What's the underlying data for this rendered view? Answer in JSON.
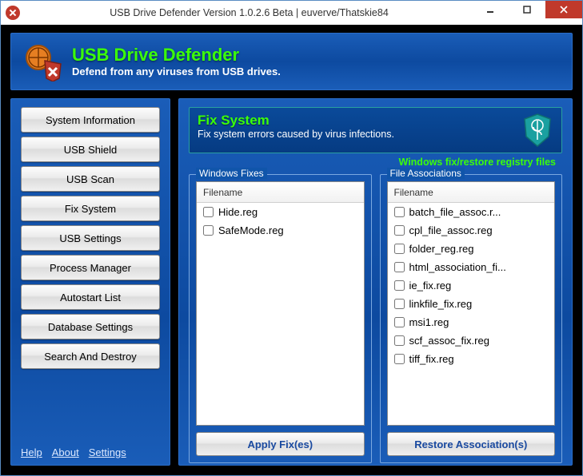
{
  "window": {
    "title": "USB Drive Defender Version 1.0.2.6 Beta | euverve/Thatskie84"
  },
  "header": {
    "product": "USB Drive Defender",
    "slogan": "Defend from any viruses from USB drives."
  },
  "sidebar": {
    "items": [
      {
        "label": "System Information"
      },
      {
        "label": "USB Shield"
      },
      {
        "label": "USB Scan"
      },
      {
        "label": "Fix System"
      },
      {
        "label": "USB Settings"
      },
      {
        "label": "Process Manager"
      },
      {
        "label": "Autostart List"
      },
      {
        "label": "Database Settings"
      },
      {
        "label": "Search And Destroy"
      }
    ],
    "links": {
      "help": "Help",
      "about": "About",
      "settings": "Settings"
    }
  },
  "main": {
    "title": "Fix System",
    "subtitle": "Fix system errors caused by virus infections.",
    "note": "Windows fix/restore registry files",
    "windows_fixes": {
      "legend": "Windows Fixes",
      "column": "Filename",
      "items": [
        {
          "name": "Hide.reg",
          "checked": false
        },
        {
          "name": "SafeMode.reg",
          "checked": false
        }
      ],
      "action": "Apply Fix(es)"
    },
    "file_assoc": {
      "legend": "File Associations",
      "column": "Filename",
      "items": [
        {
          "name": "batch_file_assoc.r...",
          "checked": false
        },
        {
          "name": "cpl_file_assoc.reg",
          "checked": false
        },
        {
          "name": "folder_reg.reg",
          "checked": false
        },
        {
          "name": "html_association_fi...",
          "checked": false
        },
        {
          "name": "ie_fix.reg",
          "checked": false
        },
        {
          "name": "linkfile_fix.reg",
          "checked": false
        },
        {
          "name": "msi1.reg",
          "checked": false
        },
        {
          "name": "scf_assoc_fix.reg",
          "checked": false
        },
        {
          "name": "tiff_fix.reg",
          "checked": false
        }
      ],
      "action": "Restore Association(s)"
    }
  }
}
